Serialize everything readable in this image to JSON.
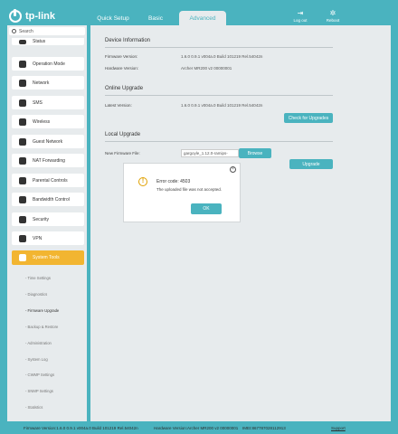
{
  "header": {
    "logo_text": "tp-link",
    "tabs": [
      "Quick Setup",
      "Basic",
      "Advanced"
    ],
    "logout": "Log out",
    "reboot": "Reboot"
  },
  "sidebar": {
    "search_placeholder": "Search",
    "items": [
      {
        "label": "Status",
        "icon": "status-icon"
      },
      {
        "label": "Operation Mode",
        "icon": "toggle-icon"
      },
      {
        "label": "Network",
        "icon": "globe-icon"
      },
      {
        "label": "SMS",
        "icon": "envelope-icon"
      },
      {
        "label": "Wireless",
        "icon": "wifi-icon"
      },
      {
        "label": "Guest Network",
        "icon": "people-icon"
      },
      {
        "label": "NAT Forwarding",
        "icon": "nat-icon"
      },
      {
        "label": "Parental Controls",
        "icon": "parental-icon"
      },
      {
        "label": "Bandwidth Control",
        "icon": "bandwidth-icon"
      },
      {
        "label": "Security",
        "icon": "shield-icon"
      },
      {
        "label": "VPN",
        "icon": "vpn-icon"
      },
      {
        "label": "System Tools",
        "icon": "gear-icon"
      }
    ],
    "active_index": 11,
    "subitems": [
      "- Time Settings",
      "- Diagnostics",
      "- Firmware Upgrade",
      "- Backup & Restore",
      "- Administration",
      "- System Log",
      "- CWMP Settings",
      "- SNMP Settings",
      "- Statistics"
    ],
    "active_subitem": 2
  },
  "main": {
    "device_info": {
      "title": "Device Information",
      "firmware_label": "Firmware Version:",
      "firmware_value": "1.6.0 0.9.1 v004a.0 Build 101219 Rel.54042n",
      "hardware_label": "Hardware Version:",
      "hardware_value": "Archer MR200 v2 00000001"
    },
    "online_upgrade": {
      "title": "Online Upgrade",
      "latest_label": "Latest Version:",
      "latest_value": "1.6.0 0.9.1 v004a.0 Build 101219 Rel.54042n",
      "check_button": "Check for Upgrades"
    },
    "local_upgrade": {
      "title": "Local Upgrade",
      "file_label": "New Firmware File:",
      "file_value": "gargoyle_1.12.0-ramips-",
      "browse_button": "Browse",
      "upgrade_button": "Upgrade"
    }
  },
  "dialog": {
    "title": "Error code: 4503",
    "message": "The uploaded file was not accepted.",
    "ok_button": "OK"
  },
  "footer": {
    "firmware": "Firmware Version:1.6.0 0.9.1 v004a.0 Build 101219 Rel.54042n",
    "hardware": "Hardware Version:Archer MR200 v2 00000001",
    "imei": "IMEI:867787028112913",
    "support": "Support"
  },
  "colors": {
    "accent": "#4ab3bf",
    "active": "#f2b531",
    "panel": "#e7ebed"
  }
}
